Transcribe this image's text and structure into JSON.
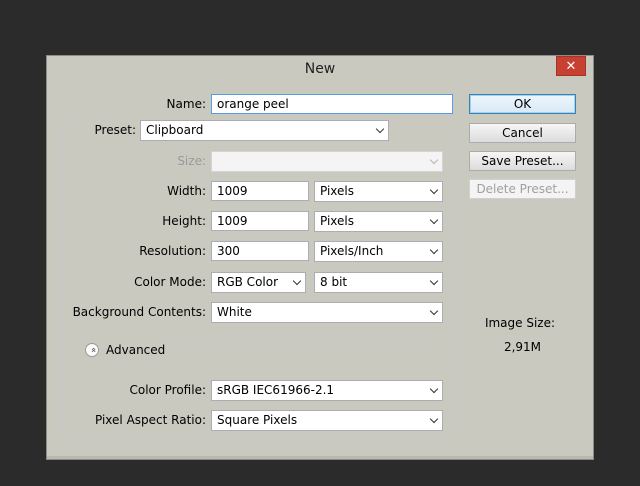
{
  "dialog": {
    "title": "New",
    "close_label": "✕"
  },
  "form": {
    "name": {
      "label": "Name:",
      "value": "orange peel"
    },
    "preset": {
      "label": "Preset:",
      "value": "Clipboard"
    },
    "size": {
      "label": "Size:",
      "value": ""
    },
    "width": {
      "label": "Width:",
      "value": "1009",
      "unit": "Pixels"
    },
    "height": {
      "label": "Height:",
      "value": "1009",
      "unit": "Pixels"
    },
    "resolution": {
      "label": "Resolution:",
      "value": "300",
      "unit": "Pixels/Inch"
    },
    "color_mode": {
      "label": "Color Mode:",
      "value": "RGB Color",
      "depth": "8 bit"
    },
    "background": {
      "label": "Background Contents:",
      "value": "White"
    },
    "advanced": {
      "label": "Advanced",
      "toggle_glyph": "«"
    },
    "color_profile": {
      "label": "Color Profile:",
      "value": "sRGB IEC61966-2.1"
    },
    "pixel_aspect": {
      "label": "Pixel Aspect Ratio:",
      "value": "Square Pixels"
    }
  },
  "buttons": {
    "ok": "OK",
    "cancel": "Cancel",
    "save_preset": "Save Preset...",
    "delete_preset": "Delete Preset..."
  },
  "image_size": {
    "label": "Image Size:",
    "value": "2,91M"
  }
}
